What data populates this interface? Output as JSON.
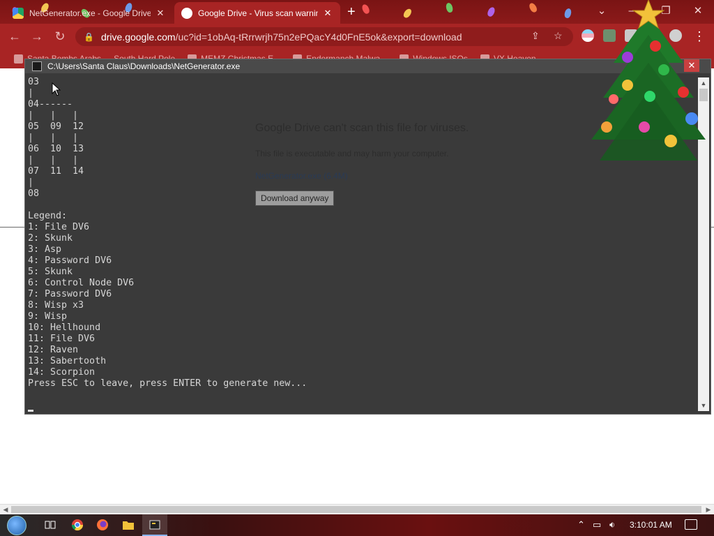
{
  "browser": {
    "tabs": [
      {
        "title": "NetGenerator.exe - Google Drive",
        "active": false
      },
      {
        "title": "Google Drive - Virus scan warning",
        "active": true
      }
    ],
    "address": {
      "host": "drive.google.com",
      "path": "/uc?id=1obAq-tRrrwrjh75n2ePQacY4d0FnE5ok&export=download"
    },
    "bookmarks": [
      "Santa Bombs Arabs",
      "South Hard Pole",
      "MEMZ Christmas E...",
      "Endermanch Malwa...",
      "Windows ISOs",
      "VX Heaven"
    ],
    "new_tab_symbol": "+"
  },
  "drive_warning": {
    "heading": "Google Drive can't scan this file for viruses.",
    "text": "This file is executable and may harm your computer.",
    "file": "NetGenerator.exe (6.4M)",
    "download_button": "Download anyway"
  },
  "console": {
    "title": "C:\\Users\\Santa Claus\\Downloads\\NetGenerator.exe",
    "output": "03\n|\n04------\n|   |   |\n05  09  12\n|   |   |\n06  10  13\n|   |   |\n07  11  14\n|\n08\n\nLegend:\n1: File DV6\n2: Skunk\n3: Asp\n4: Password DV6\n5: Skunk\n6: Control Node DV6\n7: Password DV6\n8: Wisp x3\n9: Wisp\n10: Hellhound\n11: File DV6\n12: Raven\n13: Sabertooth\n14: Scorpion\nPress ESC to leave, press ENTER to generate new..."
  },
  "taskbar": {
    "clock": "3:10:01 AM",
    "apps": [
      "task-view-icon",
      "chrome-icon",
      "firefox-icon",
      "file-explorer-icon",
      "console-app-icon"
    ]
  },
  "colors": {
    "chrome_accent": "#a82424",
    "console_bg": "#3a3a3a",
    "console_text": "#d6d6d6"
  }
}
